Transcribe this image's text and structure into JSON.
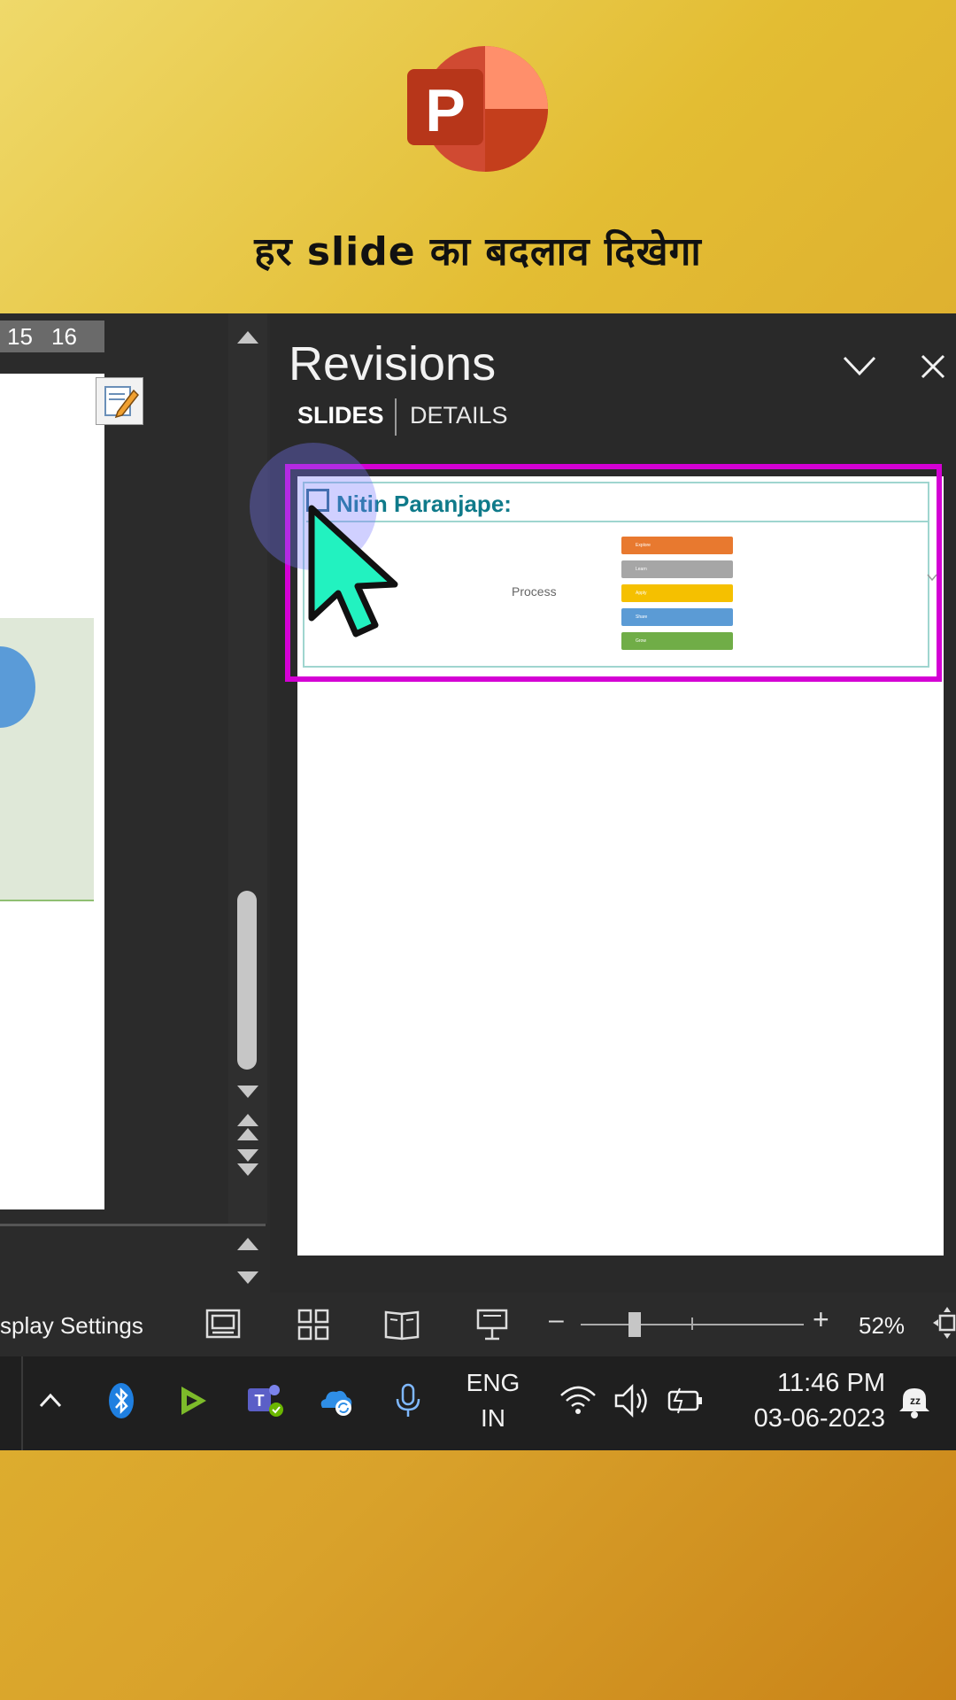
{
  "header": {
    "logo_letter": "P",
    "caption": "हर slide का बदलाव दिखेगा"
  },
  "editor": {
    "ruler_numbers": [
      "15",
      "16"
    ]
  },
  "revisions": {
    "title": "Revisions",
    "tabs": {
      "slides": "SLIDES",
      "details": "DETAILS"
    },
    "card": {
      "title": "Nitin Paranjape:",
      "process_label": "Process",
      "mini_bars": [
        {
          "label": "Explore",
          "color": "#e8792f"
        },
        {
          "label": "Learn",
          "color": "#a6a6a6"
        },
        {
          "label": "Apply",
          "color": "#f5c000"
        },
        {
          "label": "Share",
          "color": "#5b9bd5"
        },
        {
          "label": "Grow",
          "color": "#70ad47"
        }
      ]
    }
  },
  "statusbar": {
    "display_settings": "splay Settings",
    "zoom_minus": "–",
    "zoom_plus": "+",
    "zoom_percent": "52%",
    "zoom_level": 0.52
  },
  "taskbar": {
    "lang_line1": "ENG",
    "lang_line2": "IN",
    "time": "11:46 PM",
    "date": "03-06-2023"
  },
  "colors": {
    "highlight": "#d400d4",
    "cursor": "#22f2c0",
    "ppt_red": "#c43e1c"
  }
}
